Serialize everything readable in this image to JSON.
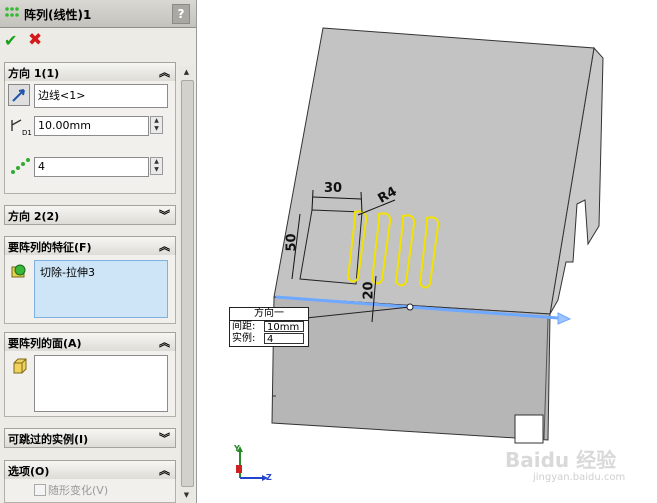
{
  "panel": {
    "title": "阵列(线性)1",
    "help_label": "?",
    "ok_symbol": "✔",
    "cancel_symbol": "✖",
    "direction1": {
      "header": "方向 1(1)",
      "edge_value": "边线<1>",
      "spacing_value": "10.00mm",
      "instances_value": "4"
    },
    "direction2": {
      "header": "方向 2(2)"
    },
    "features": {
      "header": "要阵列的特征(F)",
      "items": [
        "切除-拉伸3"
      ]
    },
    "faces": {
      "header": "要阵列的面(A)"
    },
    "skip": {
      "header": "可跳过的实例(I)"
    },
    "options": {
      "header": "选项(O)",
      "checkbox_label": "随形变化(V)"
    }
  },
  "callout": {
    "title": "方向一",
    "spacing_label": "间距:",
    "spacing_value": "10mm",
    "count_label": "实例:",
    "count_value": "4"
  },
  "dimensions": {
    "width": "30",
    "radius": "R4",
    "height": "50",
    "offset": "20"
  },
  "triad": {
    "y_label": "Y",
    "z_label": "Z"
  },
  "watermark": {
    "brand": "Baidu 经验",
    "url": "jingyan.baidu.com"
  },
  "colors": {
    "ok": "#19a219",
    "cancel": "#d21a1a",
    "selection": "#cde5f7",
    "highlight": "#f2e200",
    "edge": "#6fa8ff"
  }
}
